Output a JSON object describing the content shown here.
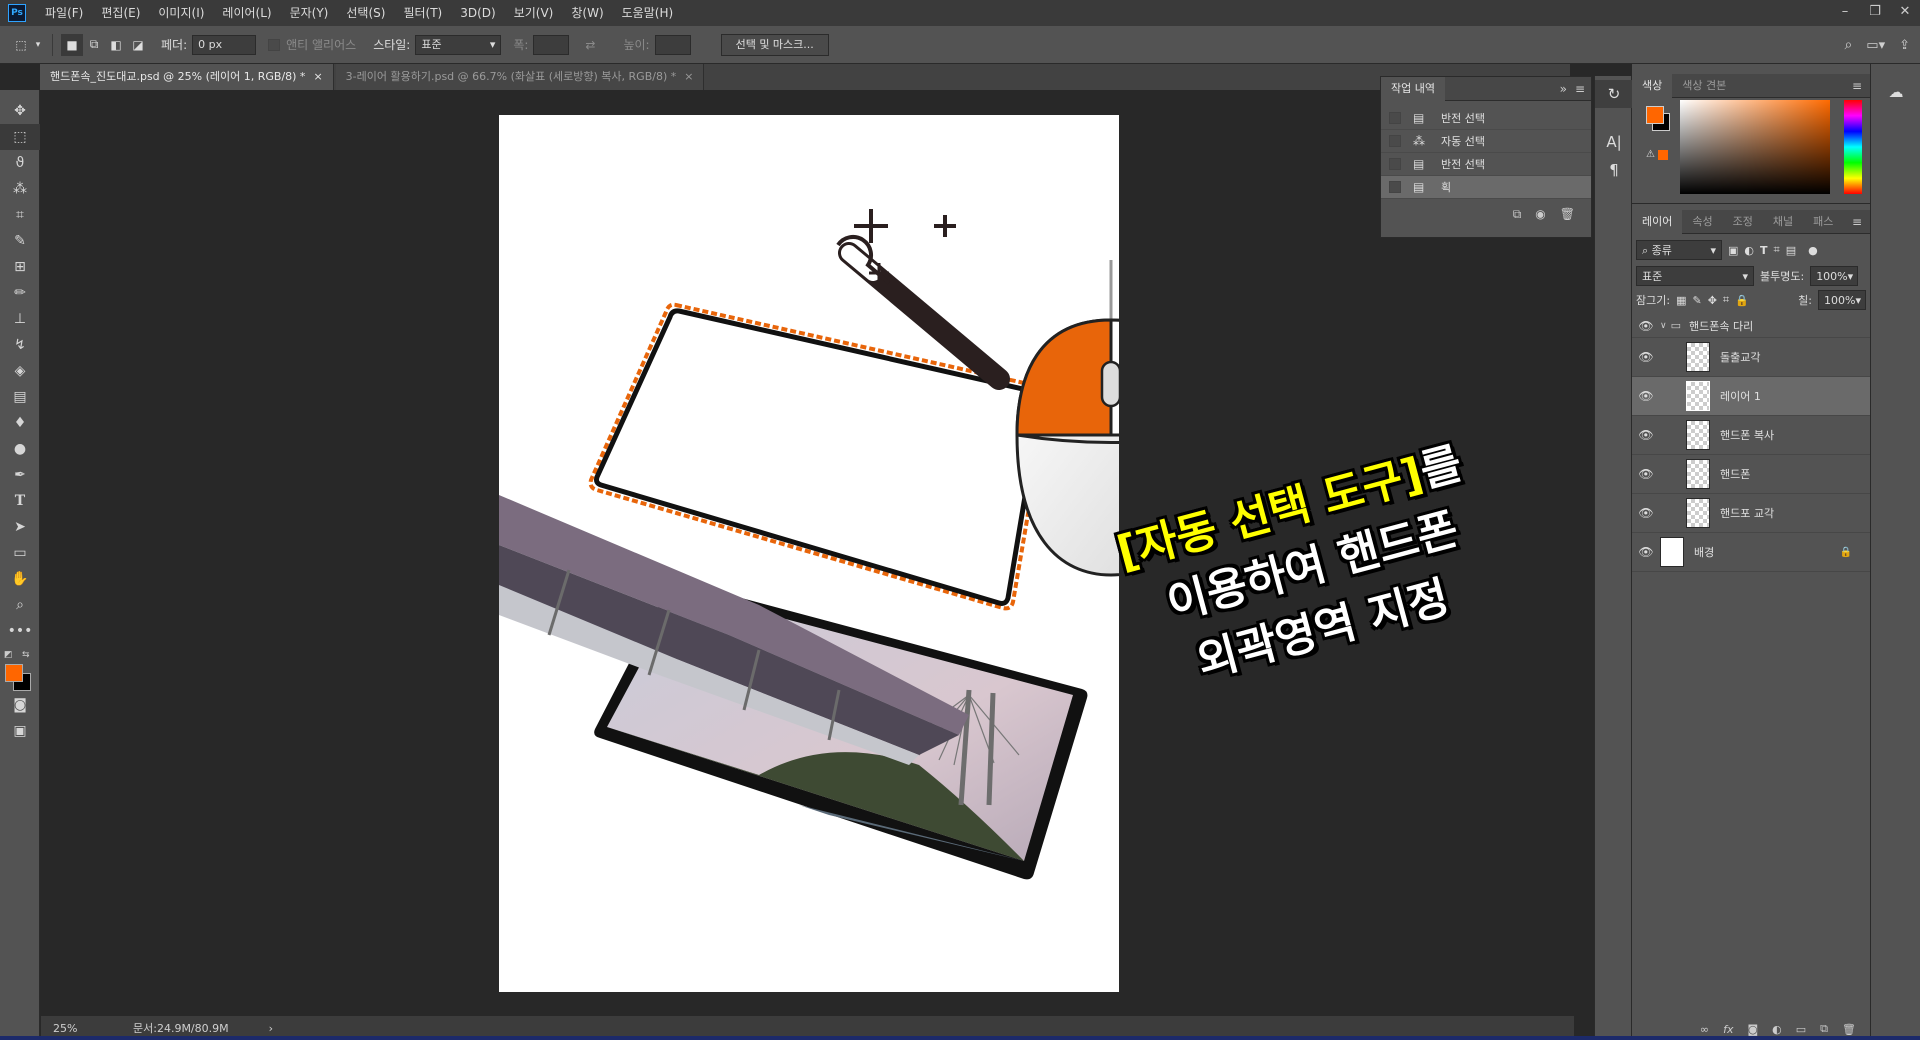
{
  "menubar": {
    "logo": "Ps",
    "items": [
      "파일(F)",
      "편집(E)",
      "이미지(I)",
      "레이어(L)",
      "문자(Y)",
      "선택(S)",
      "필터(T)",
      "3D(D)",
      "보기(V)",
      "창(W)",
      "도움말(H)"
    ]
  },
  "options": {
    "feather_label": "페더:",
    "feather_value": "0 px",
    "antialias_label": "앤티 앨리어스",
    "style_label": "스타일:",
    "style_value": "표준",
    "width_label": "폭:",
    "height_label": "높이:",
    "select_mask_label": "선택 및 마스크..."
  },
  "tabs": [
    {
      "label": "핸드폰속_진도대교.psd @ 25% (레이어 1, RGB/8) *",
      "close": "×"
    },
    {
      "label": "3-레이어 활용하기.psd @ 66.7% (화살표 (세로방향) 복사, RGB/8) *",
      "close": "×"
    }
  ],
  "history": {
    "tab": "작업 내역",
    "rows": [
      {
        "label": "반전 선택",
        "icon": "document-icon"
      },
      {
        "label": "자동 선택",
        "icon": "magic-wand-icon"
      },
      {
        "label": "반전 선택",
        "icon": "document-icon"
      },
      {
        "label": "획",
        "icon": "document-icon"
      }
    ]
  },
  "color": {
    "tabs": [
      "색상",
      "색상 견본"
    ],
    "foreground": "#ff6600",
    "background": "#000000"
  },
  "layers": {
    "tabs": [
      "레이어",
      "속성",
      "조정",
      "채널",
      "패스"
    ],
    "filter_label": "종류",
    "blend_mode": "표준",
    "opacity_label": "불투명도:",
    "opacity_value": "100%",
    "lock_label": "잠그기:",
    "fill_label": "칠:",
    "fill_value": "100%",
    "group_name": "핸드폰속 다리",
    "items": [
      {
        "name": "돌출교각"
      },
      {
        "name": "레이어 1"
      },
      {
        "name": "핸드폰 복사"
      },
      {
        "name": "핸드폰"
      },
      {
        "name": "핸드포 교각"
      },
      {
        "name": "배경"
      }
    ]
  },
  "status": {
    "zoom": "25%",
    "doc": "문서:24.9M/80.9M",
    "arrow": "›"
  },
  "caption": {
    "line1_highlight": "[자동 선택 도구]",
    "line1_rest": "를",
    "line2": "이용하여 핸드폰",
    "line3": "외곽영역 지정"
  },
  "illustration": {
    "accent_color": "#e8650a"
  }
}
